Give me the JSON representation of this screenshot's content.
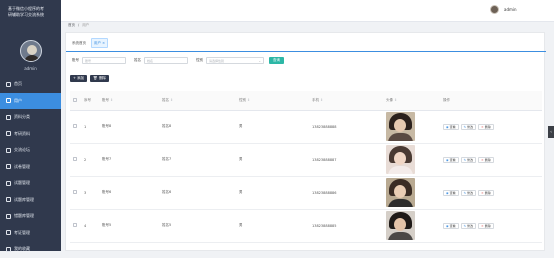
{
  "sidebar": {
    "title_line1": "基于微信小程序的考",
    "title_line2": "研辅助学习交流系统",
    "username": "admin",
    "items": [
      {
        "label": "首页",
        "icon": "home-icon",
        "active": false
      },
      {
        "label": "用户",
        "icon": "user-icon",
        "active": true
      },
      {
        "label": "资料分类",
        "icon": "folder-icon",
        "active": false
      },
      {
        "label": "考研资料",
        "icon": "book-icon",
        "active": false
      },
      {
        "label": "交流论坛",
        "icon": "chat-icon",
        "active": false
      },
      {
        "label": "试卷管理",
        "icon": "paper-icon",
        "active": false
      },
      {
        "label": "试题管理",
        "icon": "list-icon",
        "active": false
      },
      {
        "label": "试题库管理",
        "icon": "database-icon",
        "active": false
      },
      {
        "label": "错题库管理",
        "icon": "error-book-icon",
        "active": false
      },
      {
        "label": "考证管理",
        "icon": "certificate-icon",
        "active": false
      },
      {
        "label": "我的收藏",
        "icon": "star-icon",
        "active": false
      }
    ]
  },
  "topbar": {
    "username": "admin"
  },
  "breadcrumb": {
    "home": "首页",
    "separator": "/",
    "current": "用户"
  },
  "tabs": {
    "home": "系统首页",
    "current": "用户 ×"
  },
  "filters": {
    "account_label": "账号",
    "account_placeholder": "账号",
    "name_label": "姓名",
    "name_placeholder": "姓名",
    "gender_label": "性别",
    "gender_placeholder": "请选择性别",
    "search_label": "查询"
  },
  "actions": {
    "add_label": "+ 添加",
    "delete_label": "删除"
  },
  "table": {
    "headers": [
      "",
      "序号",
      "账号",
      "姓名",
      "性别",
      "手机",
      "头像",
      "操作"
    ],
    "rows": [
      {
        "index": "1",
        "account": "账号8",
        "name": "姓名8",
        "gender": "男",
        "phone": "13823888888"
      },
      {
        "index": "2",
        "account": "账号7",
        "name": "姓名7",
        "gender": "男",
        "phone": "13823888887"
      },
      {
        "index": "3",
        "account": "账号6",
        "name": "姓名6",
        "gender": "男",
        "phone": "13823888886"
      },
      {
        "index": "4",
        "account": "账号5",
        "name": "姓名5",
        "gender": "男",
        "phone": "13823888885"
      }
    ],
    "ops": {
      "view": "查看",
      "edit": "修改",
      "delete": "删除"
    }
  },
  "colors": {
    "sidebar": "#30394d",
    "accent": "#3c8ee0",
    "search_button": "#2db7a6"
  }
}
